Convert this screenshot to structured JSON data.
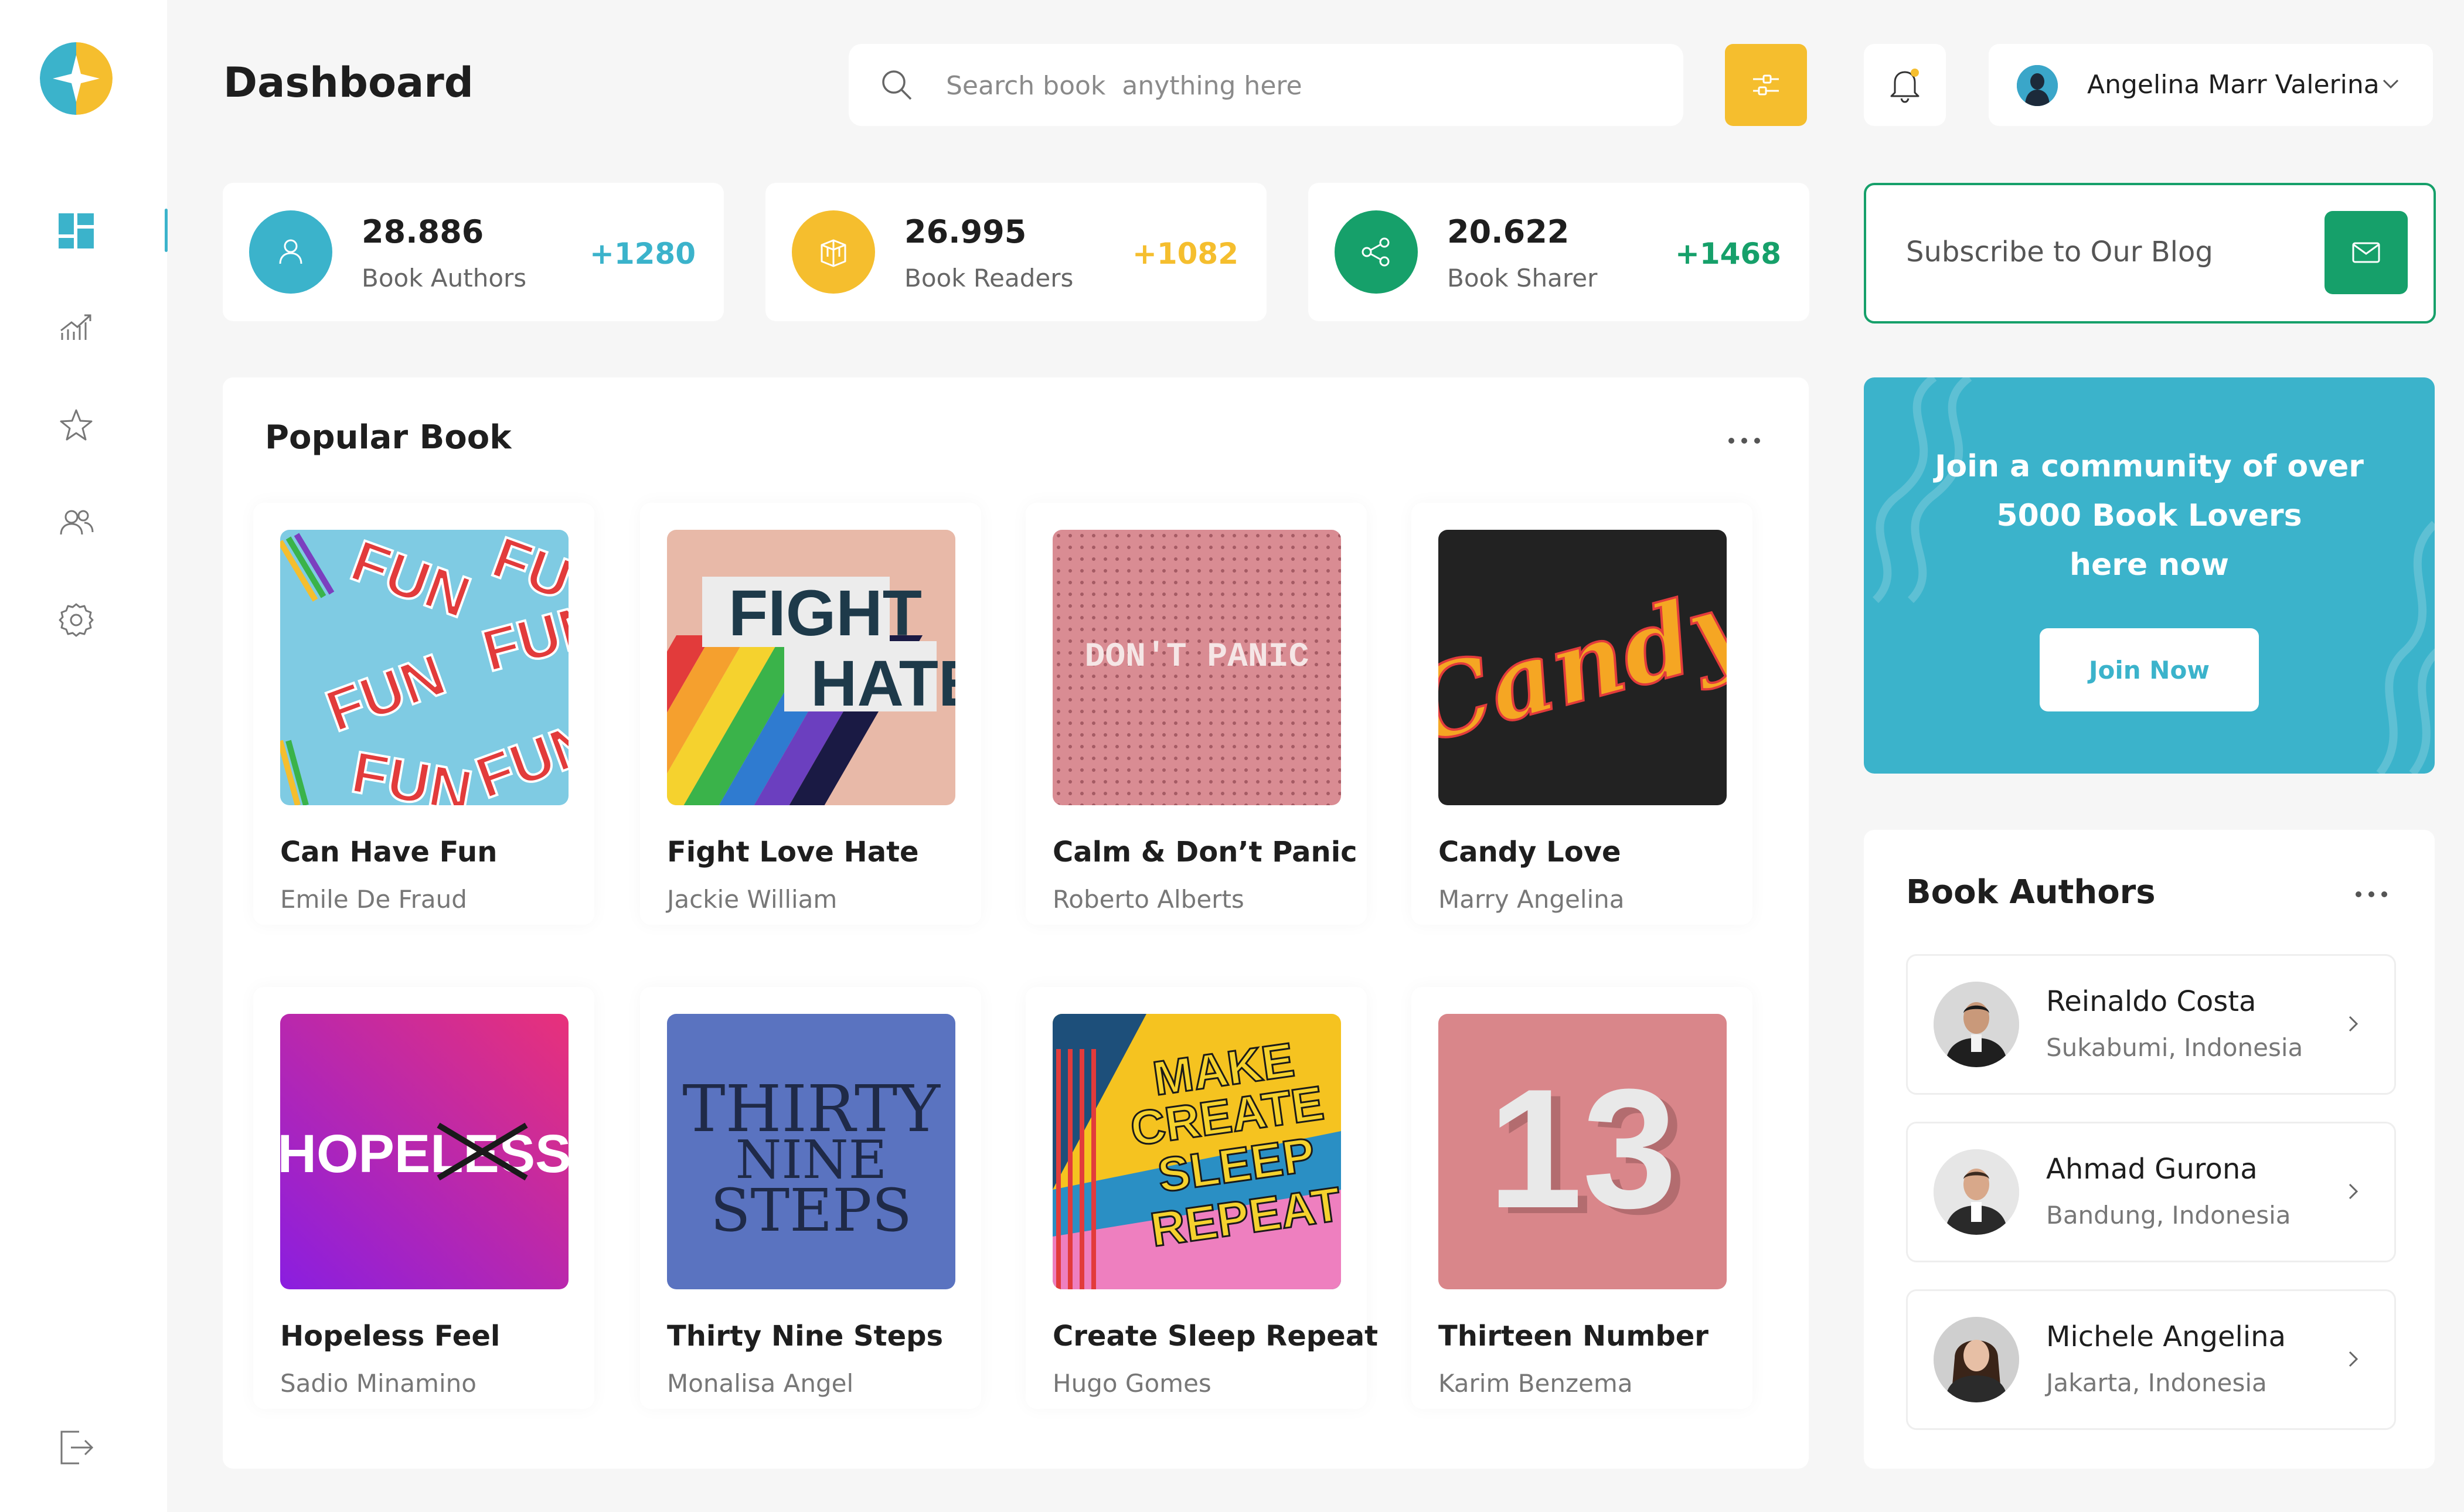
{
  "header": {
    "title": "Dashboard",
    "search_placeholder": "Search book  anything here",
    "user_name": "Angelina Marr Valerina"
  },
  "stats": [
    {
      "value": "28.886",
      "label": "Book Authors",
      "delta": "+1280",
      "color": "#3bb3cb",
      "icon": "user-icon"
    },
    {
      "value": "26.995",
      "label": "Book Readers",
      "delta": "+1082",
      "color": "#f5be2e",
      "icon": "book-icon"
    },
    {
      "value": "20.622",
      "label": "Book Sharer",
      "delta": "+1468",
      "color": "#16a06a",
      "icon": "share-icon"
    }
  ],
  "subscribe": {
    "text": "Subscribe to Our Blog"
  },
  "community": {
    "line1": "Join a community of over",
    "line2": "5000 Book Lovers",
    "line3": "here now",
    "button": "Join Now"
  },
  "popular": {
    "title": "Popular Book",
    "books": [
      {
        "title": "Can Have Fun",
        "author": "Emile De Fraud",
        "cover_text": "FUN"
      },
      {
        "title": "Fight Love Hate",
        "author": "Jackie William",
        "cover_text_1": "FIGHT",
        "cover_text_2": "HATE"
      },
      {
        "title": "Calm & Don’t Panic",
        "author": "Roberto Alberts",
        "cover_text": "DON'T PANIC"
      },
      {
        "title": "Candy Love",
        "author": "Marry Angelina",
        "cover_text": "Candy"
      },
      {
        "title": "Hopeless Feel",
        "author": "Sadio Minamino",
        "cover_text": "HOPELESS"
      },
      {
        "title": "Thirty Nine Steps",
        "author": "Monalisa Angel",
        "cover_text_1": "THIRTY",
        "cover_text_2": "NINE",
        "cover_text_3": "STEPS"
      },
      {
        "title": "Create Sleep Repeat",
        "author": "Hugo Gomes",
        "cover_text_1": "MAKE",
        "cover_text_2": "CREATE",
        "cover_text_3": "SLEEP",
        "cover_text_4": "REPEAT"
      },
      {
        "title": "Thirteen Number",
        "author": "Karim Benzema",
        "cover_text": "13"
      }
    ]
  },
  "authors": {
    "title": "Book Authors",
    "items": [
      {
        "name": "Reinaldo Costa",
        "location": "Sukabumi, Indonesia"
      },
      {
        "name": "Ahmad Gurona",
        "location": "Bandung, Indonesia"
      },
      {
        "name": "Michele Angelina",
        "location": "Jakarta, Indonesia"
      }
    ]
  },
  "colors": {
    "accent": "#3bb3cb",
    "yellow": "#f5be2e",
    "green": "#16a06a"
  }
}
